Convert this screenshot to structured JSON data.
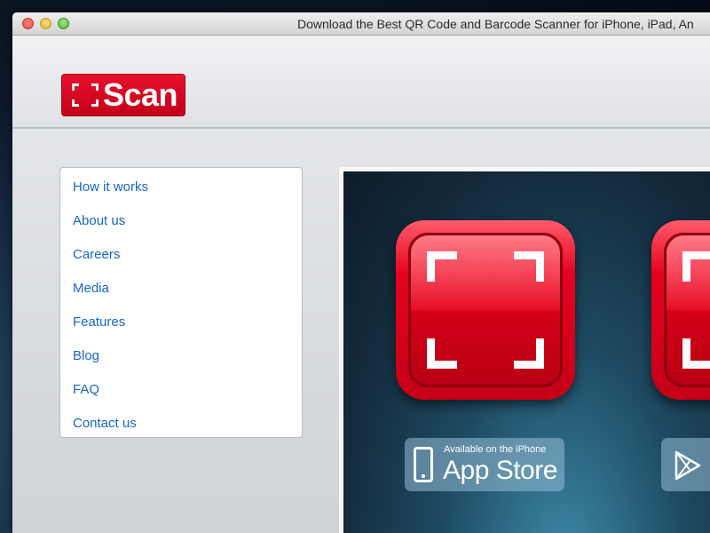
{
  "window": {
    "title": "Download the Best QR Code and Barcode Scanner for iPhone, iPad, An"
  },
  "header": {
    "logo_text": "Scan",
    "logo_color": "#e0001b"
  },
  "nav": {
    "items": [
      {
        "label": "How it works"
      },
      {
        "label": "About us"
      },
      {
        "label": "Careers"
      },
      {
        "label": "Media"
      },
      {
        "label": "Features"
      },
      {
        "label": "Blog"
      },
      {
        "label": "FAQ"
      },
      {
        "label": "Contact us"
      }
    ],
    "link_color": "#1566c6"
  },
  "hero": {
    "app_store_badge": {
      "small_text": "Available on the iPhone",
      "big_text": "App Store",
      "icon": "iphone-icon"
    },
    "play_badge": {
      "icon": "google-play-icon"
    },
    "app_icon": "scan-app-icon"
  }
}
